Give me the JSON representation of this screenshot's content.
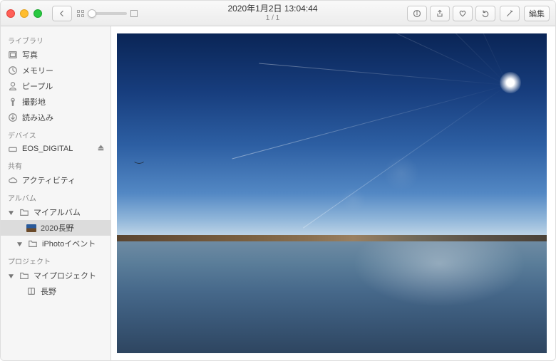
{
  "toolbar": {
    "title_date": "2020年1月2日 13:04:44",
    "counter": "1 / 1",
    "edit_label": "編集"
  },
  "sidebar": {
    "section_library": "ライブラリ",
    "library": {
      "photos": "写真",
      "memories": "メモリー",
      "people": "ピープル",
      "places": "撮影地",
      "imports": "読み込み"
    },
    "section_devices": "デバイス",
    "devices": {
      "eos": "EOS_DIGITAL"
    },
    "section_shared": "共有",
    "shared": {
      "activity": "アクティビティ"
    },
    "section_albums": "アルバム",
    "albums": {
      "myalbums": "マイアルバム",
      "nagano2020": "2020長野",
      "iphoto_events": "iPhotoイベント"
    },
    "section_projects": "プロジェクト",
    "projects": {
      "myprojects": "マイプロジェクト",
      "nagano": "長野"
    }
  }
}
